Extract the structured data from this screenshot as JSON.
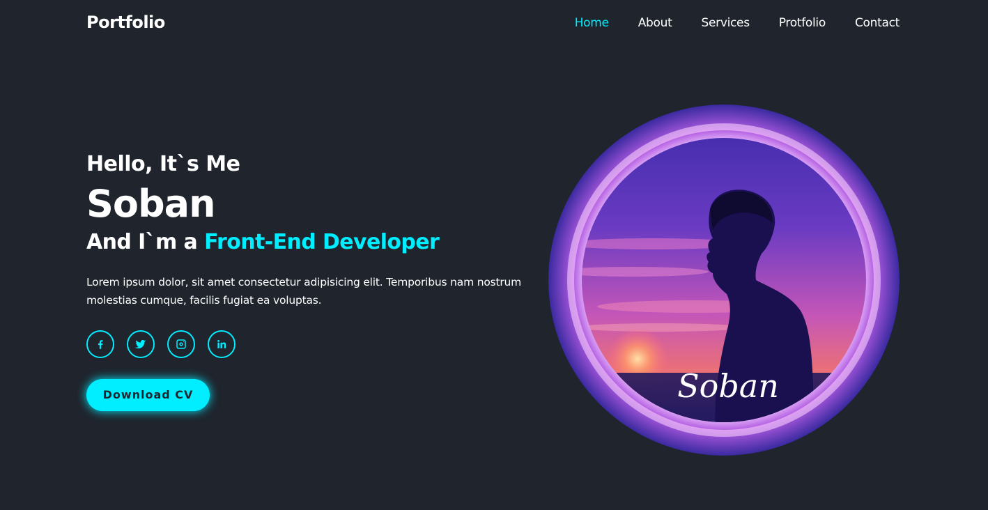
{
  "header": {
    "logo": "Portfolio",
    "nav": [
      {
        "label": "Home",
        "active": true
      },
      {
        "label": "About",
        "active": false
      },
      {
        "label": "Services",
        "active": false
      },
      {
        "label": "Protfolio",
        "active": false
      },
      {
        "label": "Contact",
        "active": false
      }
    ]
  },
  "hero": {
    "greeting": "Hello, It`s Me",
    "name": "Soban",
    "role_prefix": "And I`m a",
    "role": "Front-End Developer",
    "description": "Lorem ipsum dolor, sit amet consectetur adipisicing elit. Temporibus nam nostrum molestias cumque, facilis fugiat ea voluptas.",
    "social_icons": [
      "facebook-icon",
      "twitter-icon",
      "instagram-icon",
      "linkedin-icon"
    ],
    "button_label": "Download CV",
    "portrait_signature": "Soban"
  },
  "colors": {
    "background": "#1f242d",
    "accent": "#00eeff",
    "text": "#ffffff"
  }
}
